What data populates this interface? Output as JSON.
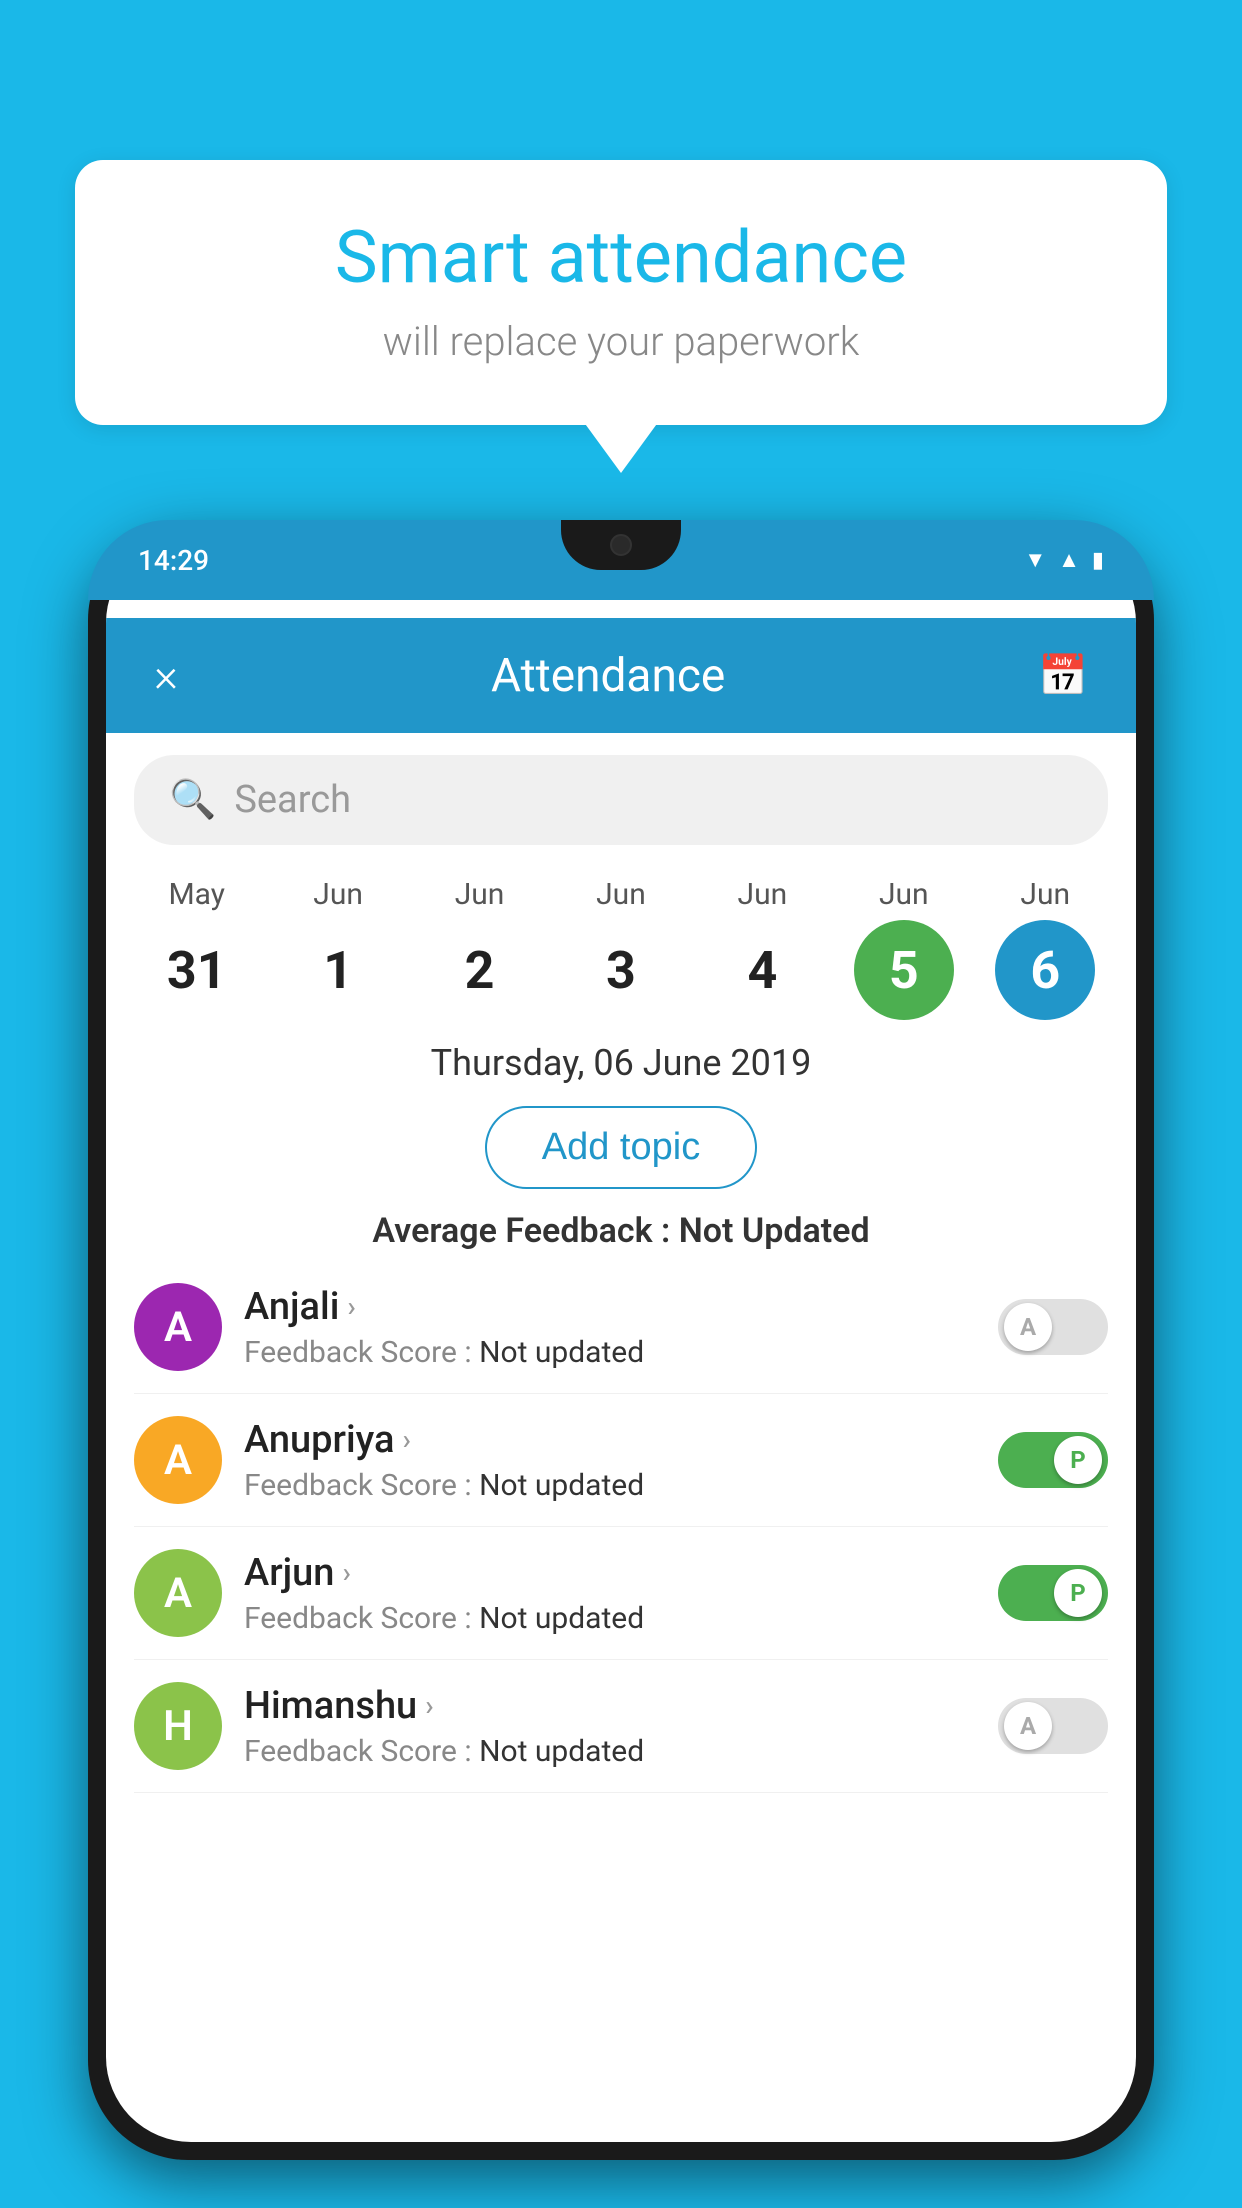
{
  "background_color": "#1ab8e8",
  "bubble": {
    "title": "Smart attendance",
    "subtitle": "will replace your paperwork"
  },
  "phone": {
    "status_bar": {
      "time": "14:29"
    },
    "header": {
      "title": "Attendance",
      "close_icon": "×",
      "calendar_icon": "📅"
    },
    "search": {
      "placeholder": "Search"
    },
    "calendar": {
      "dates": [
        {
          "month": "May",
          "day": "31",
          "state": "normal"
        },
        {
          "month": "Jun",
          "day": "1",
          "state": "normal"
        },
        {
          "month": "Jun",
          "day": "2",
          "state": "normal"
        },
        {
          "month": "Jun",
          "day": "3",
          "state": "normal"
        },
        {
          "month": "Jun",
          "day": "4",
          "state": "normal"
        },
        {
          "month": "Jun",
          "day": "5",
          "state": "today"
        },
        {
          "month": "Jun",
          "day": "6",
          "state": "selected"
        }
      ]
    },
    "selected_date_label": "Thursday, 06 June 2019",
    "add_topic_label": "Add topic",
    "avg_feedback_prefix": "Average Feedback : ",
    "avg_feedback_value": "Not Updated",
    "students": [
      {
        "name": "Anjali",
        "feedback_label": "Feedback Score : ",
        "feedback_value": "Not updated",
        "avatar_letter": "A",
        "avatar_color": "#9c27b0",
        "toggle_state": "off",
        "toggle_label": "A"
      },
      {
        "name": "Anupriya",
        "feedback_label": "Feedback Score : ",
        "feedback_value": "Not updated",
        "avatar_letter": "A",
        "avatar_color": "#f9a825",
        "toggle_state": "on",
        "toggle_label": "P"
      },
      {
        "name": "Arjun",
        "feedback_label": "Feedback Score : ",
        "feedback_value": "Not updated",
        "avatar_letter": "A",
        "avatar_color": "#8bc34a",
        "toggle_state": "on",
        "toggle_label": "P"
      },
      {
        "name": "Himanshu",
        "feedback_label": "Feedback Score : ",
        "feedback_value": "Not updated",
        "avatar_letter": "H",
        "avatar_color": "#8bc34a",
        "toggle_state": "off",
        "toggle_label": "A"
      }
    ]
  }
}
